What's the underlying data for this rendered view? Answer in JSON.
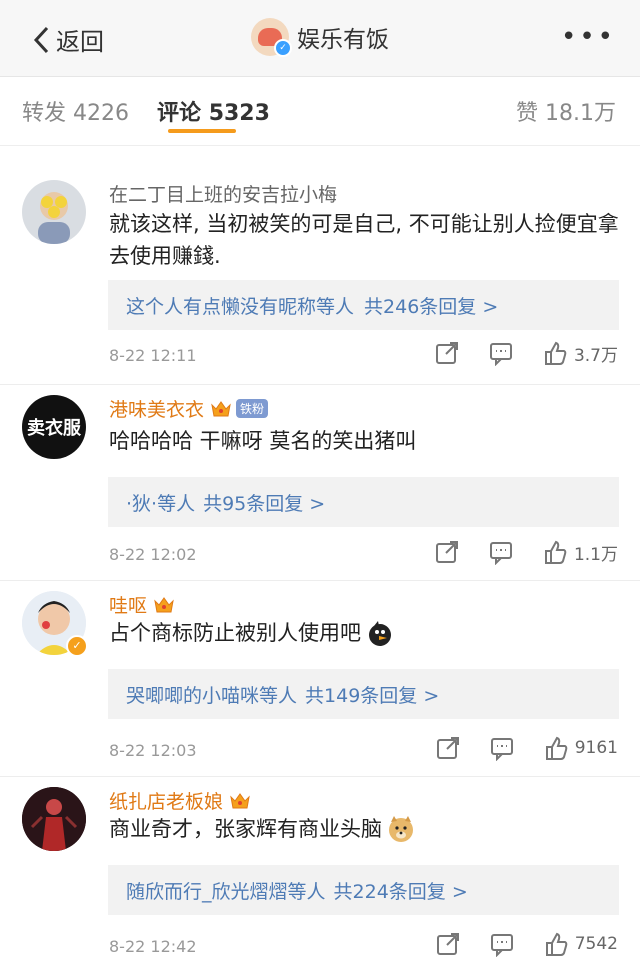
{
  "header": {
    "back_label": "返回",
    "title": "娱乐有饭",
    "more_icon": "more-icon"
  },
  "tabs": {
    "forward": {
      "label": "转发",
      "count": "4226"
    },
    "comments": {
      "label": "评论",
      "count": "5323"
    },
    "likes": {
      "label": "赞",
      "count": "18.1万"
    }
  },
  "comments": [
    {
      "name": "在二丁目上班的安吉拉小梅",
      "text": "就该这样, 当初被笑的可是自己, 不可能让别人捡便宜拿去使用赚錢.",
      "reply_users": "这个人有点懒没有昵称等人",
      "reply_count": "共246条回复 >",
      "time": "8-22 12:11",
      "likes": "3.7万"
    },
    {
      "name": "港味美衣衣",
      "badge": "铁粉",
      "avatar_text": "卖衣服",
      "text": "哈哈哈哈 干嘛呀 莫名的笑出猪叫",
      "reply_users": "·狄·等人",
      "reply_count": "共95条回复 >",
      "time": "8-22 12:02",
      "likes": "1.1万"
    },
    {
      "name": "哇呕",
      "text": "占个商标防止被别人使用吧",
      "reply_users": "哭唧唧的小喵咪等人",
      "reply_count": "共149条回复 >",
      "time": "8-22 12:03",
      "likes": "9161"
    },
    {
      "name": "纸扎店老板娘",
      "text": "商业奇才，张家辉有商业头脑",
      "reply_users": "随欣而行_欣光熠熠等人",
      "reply_count": "共224条回复 >",
      "time": "8-22 12:42",
      "likes": "7542"
    }
  ],
  "colors": {
    "accent": "#f59b1c",
    "link": "#4e7bb5",
    "name_orange": "#e07a16"
  }
}
